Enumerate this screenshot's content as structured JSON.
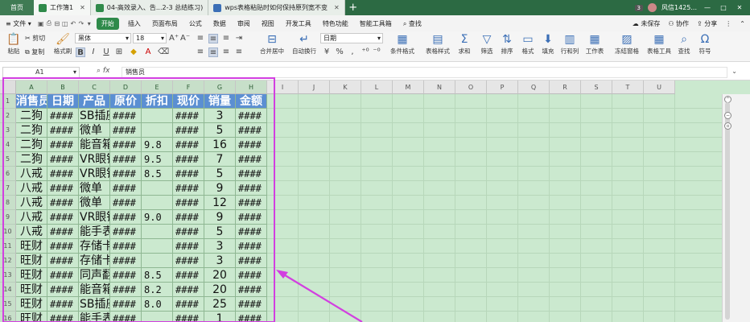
{
  "titlebar": {
    "home": "首页",
    "tabs": [
      {
        "label": "工作簿1",
        "color": "#2f8a4a",
        "active": true
      },
      {
        "label": "04-高效录入、告...2-3 总结练习)",
        "color": "#2f8a4a",
        "active": false
      },
      {
        "label": "wps表格粘贴时如何保持原列宽不变",
        "color": "#3b6fb6",
        "active": false
      }
    ],
    "plus": "+",
    "badge": "3",
    "user": "风信1425...",
    "win_min": "—",
    "win_max": "□",
    "win_close": "✕"
  },
  "menubar": {
    "file": "文件",
    "items": [
      "开始",
      "插入",
      "页面布局",
      "公式",
      "数据",
      "审阅",
      "视图",
      "开发工具",
      "特色功能",
      "智能工具箱"
    ],
    "search": "查找",
    "unsaved": "未保存",
    "collab": "协作",
    "share": "分享"
  },
  "ribbon": {
    "paste": "粘贴",
    "cut": "剪切",
    "copy": "复制",
    "format_painter": "格式刷",
    "font_name": "黑体",
    "font_size": "18",
    "merge": "合并居中",
    "wrap": "自动换行",
    "number_format": "日期",
    "cond_format": "条件格式",
    "table_style": "表格样式",
    "sum": "求和",
    "filter": "筛选",
    "sort": "排序",
    "format": "格式",
    "fill": "填充",
    "rowcol": "行和列",
    "worksheet": "工作表",
    "freeze": "冻结窗格",
    "table_tools": "表格工具",
    "find": "查找",
    "symbol": "符号"
  },
  "formula_bar": {
    "name_box": "A1",
    "fx": "fx",
    "value": "销售员"
  },
  "sheet": {
    "columns": [
      "A",
      "B",
      "C",
      "D",
      "E",
      "F",
      "G",
      "H",
      "I",
      "J",
      "K",
      "L",
      "M",
      "N",
      "O",
      "P",
      "Q",
      "R",
      "S",
      "T",
      "U"
    ],
    "rows": [
      "1",
      "2",
      "3",
      "4",
      "5",
      "6",
      "7",
      "8",
      "9",
      "10",
      "11",
      "12",
      "13",
      "14",
      "15",
      "16"
    ],
    "header_cells": [
      "消售员",
      "日期",
      "产品",
      "原价",
      "折扣",
      "现价",
      "销量",
      "金额"
    ],
    "data": [
      [
        "二狗",
        "####",
        "SB插座",
        "####",
        "",
        "####",
        "3",
        "####"
      ],
      [
        "二狗",
        "####",
        "微单",
        "####",
        "",
        "####",
        "5",
        "####"
      ],
      [
        "二狗",
        "####",
        "能音箱",
        "####",
        "9.8",
        "####",
        "16",
        "####"
      ],
      [
        "二狗",
        "####",
        "VR眼镜",
        "####",
        "9.5",
        "####",
        "7",
        "####"
      ],
      [
        "八戒",
        "####",
        "VR眼镜",
        "####",
        "8.5",
        "####",
        "5",
        "####"
      ],
      [
        "八戒",
        "####",
        "微单",
        "####",
        "",
        "####",
        "9",
        "####"
      ],
      [
        "八戒",
        "####",
        "微单",
        "####",
        "",
        "####",
        "12",
        "####"
      ],
      [
        "八戒",
        "####",
        "VR眼镜",
        "####",
        "9.0",
        "####",
        "9",
        "####"
      ],
      [
        "八戒",
        "####",
        "能手表",
        "####",
        "",
        "####",
        "5",
        "####"
      ],
      [
        "旺财",
        "####",
        "存储卡",
        "####",
        "",
        "####",
        "3",
        "####"
      ],
      [
        "旺财",
        "####",
        "存储卡",
        "####",
        "",
        "####",
        "3",
        "####"
      ],
      [
        "旺财",
        "####",
        "同声翻",
        "####",
        "8.5",
        "####",
        "20",
        "####"
      ],
      [
        "旺财",
        "####",
        "能音箱",
        "####",
        "8.2",
        "####",
        "20",
        "####"
      ],
      [
        "旺财",
        "####",
        "SB插座",
        "####",
        "8.0",
        "####",
        "25",
        "####"
      ],
      [
        "旺财",
        "####",
        "能手表",
        "####",
        "",
        "####",
        "1",
        "####"
      ]
    ]
  },
  "colors": {
    "accent": "#2f8a4a",
    "header_fill": "#5b8fd2",
    "sheet_bg": "#cbe9cf",
    "selection_outline": "#d23fe0"
  }
}
